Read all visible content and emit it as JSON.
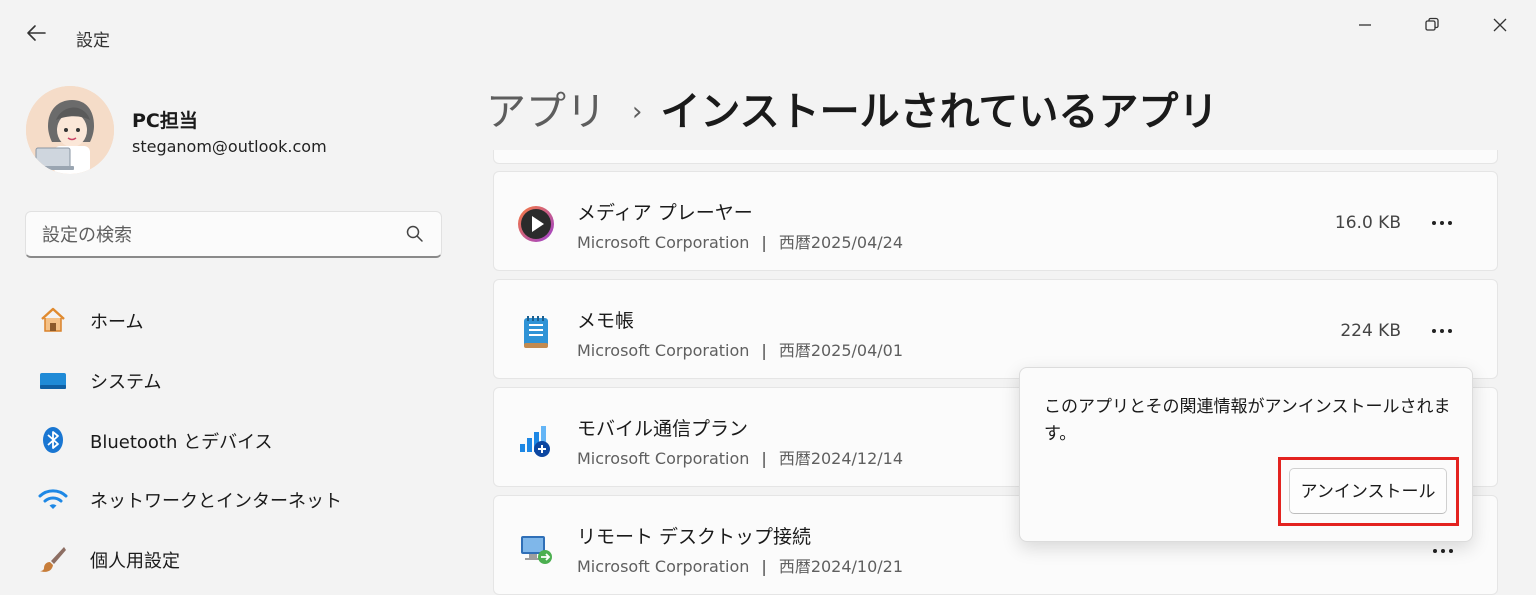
{
  "window": {
    "title": "設定",
    "controls": {
      "minimize": "—",
      "restore": "❐",
      "close": "✕"
    }
  },
  "user": {
    "name": "PC担当",
    "email": "steganom@outlook.com"
  },
  "search": {
    "placeholder": "設定の検索"
  },
  "sidebar": {
    "items": [
      {
        "label": "ホーム",
        "icon": "home-icon"
      },
      {
        "label": "システム",
        "icon": "system-icon"
      },
      {
        "label": "Bluetooth とデバイス",
        "icon": "bluetooth-icon"
      },
      {
        "label": "ネットワークとインターネット",
        "icon": "wifi-icon"
      },
      {
        "label": "個人用設定",
        "icon": "brush-icon"
      }
    ]
  },
  "header": {
    "parent": "アプリ",
    "separator": "›",
    "current": "インストールされているアプリ"
  },
  "apps": [
    {
      "name": "メディア プレーヤー",
      "publisher": "Microsoft Corporation",
      "date": "西暦2025/04/24",
      "size": "16.0 KB",
      "icon": "media-player-icon"
    },
    {
      "name": "メモ帳",
      "publisher": "Microsoft Corporation",
      "date": "西暦2025/04/01",
      "size": "224 KB",
      "icon": "notepad-icon"
    },
    {
      "name": "モバイル通信プラン",
      "publisher": "Microsoft Corporation",
      "date": "西暦2024/12/14",
      "size": "",
      "icon": "mobile-plans-icon"
    },
    {
      "name": "リモート デスクトップ接続",
      "publisher": "Microsoft Corporation",
      "date": "西暦2024/10/21",
      "size": "",
      "icon": "remote-desktop-icon"
    }
  ],
  "more_label": "•••",
  "meta_separator": "|",
  "flyout": {
    "message": "このアプリとその関連情報がアンインストールされます。",
    "button": "アンインストール"
  },
  "colors": {
    "highlight": "#e3231f",
    "accent": "#0067c0"
  }
}
